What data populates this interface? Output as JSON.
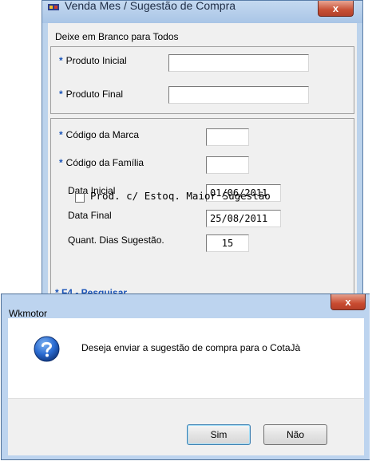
{
  "background_window": {
    "title": "Venda Mes / Sugestão de Compra",
    "close_label": "x",
    "hint": "Deixe em Branco para Todos",
    "fields": {
      "produto_inicial_label": "Produto Inicial",
      "produto_inicial_value": "",
      "produto_final_label": "Produto Final",
      "produto_final_value": "",
      "codigo_marca_label": "Código da Marca",
      "codigo_marca_value": "",
      "codigo_familia_label": "Código da Família",
      "codigo_familia_value": "",
      "data_inicial_label": "Data Inicial",
      "data_inicial_value": "01/06/2011",
      "data_final_label": "Data Final",
      "data_final_value": "25/08/2011",
      "quant_dias_label": "Quant. Dias Sugestão.",
      "quant_dias_value": "15"
    },
    "checkbox_label": "Prod. c/ Estoq. Maior Sugestão",
    "checkbox_checked": false,
    "f4_label": "* F4 - Pesquisar",
    "star": "*"
  },
  "dialog": {
    "title": "Wkmotor",
    "close_label": "x",
    "message": "Deseja enviar a sugestão de compra para o CotaJà",
    "icon": "question-icon",
    "buttons": {
      "yes": "Sim",
      "no": "Não"
    }
  }
}
